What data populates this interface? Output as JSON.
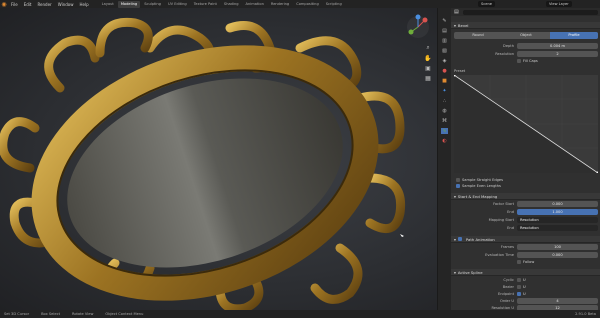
{
  "menu": [
    "File",
    "Edit",
    "Render",
    "Window",
    "Help"
  ],
  "workspace_tabs": [
    "Layout",
    "Modeling",
    "Sculpting",
    "UV Editing",
    "Texture Paint",
    "Shading",
    "Animation",
    "Rendering",
    "Compositing",
    "Scripting"
  ],
  "active_tab_index": 1,
  "scene": {
    "label": "Scene",
    "view_layer": "View Layer"
  },
  "props": {
    "panel_title": "Bevel",
    "bevel_mode": [
      "Round",
      "Object",
      "Profile"
    ],
    "bevel_mode_active": 2,
    "depth_label": "Depth",
    "depth_value": "0.004 m",
    "resolution_label": "Resolution",
    "resolution_value": "2",
    "fill_caps": "Fill Caps",
    "preset_label": "Preset",
    "sample_straight": "Sample Straight Edges",
    "sample_even": "Sample Even Lengths",
    "start_end": "Start & End Mapping",
    "factor_start_label": "Factor Start",
    "factor_start_value": "0.000",
    "end_label": "End",
    "end_value": "1.000",
    "mapping_start_label": "Mapping Start",
    "mapping_start_value": "Resolution",
    "mapping_end_label": "End",
    "mapping_end_value": "Resolution",
    "path_animation": "Path Animation",
    "frames_label": "Frames",
    "frames_value": "100",
    "eval_time_label": "Evaluation Time",
    "eval_time_value": "0.000",
    "follow": "Follow",
    "active_spline": "Active Spline",
    "cyclic_label": "Cyclic",
    "cyclic_u": "U",
    "bezier_label": "Bezier",
    "bezier_u": "U",
    "endpoint_label": "Endpoint",
    "endpoint_u": "U",
    "order_label": "Order U",
    "order_value": "4",
    "resolution_u_label": "Resolution U",
    "resolution_u_value": "12",
    "smooth": "Smooth"
  },
  "status": {
    "left": "Set 3D Cursor",
    "mid": "Box Select",
    "right": "Rotate View",
    "ctx": "Object Context Menu",
    "version": "2.91.0 Beta"
  },
  "colors": {
    "accent": "#4772b3",
    "gold": "#b8902f"
  }
}
